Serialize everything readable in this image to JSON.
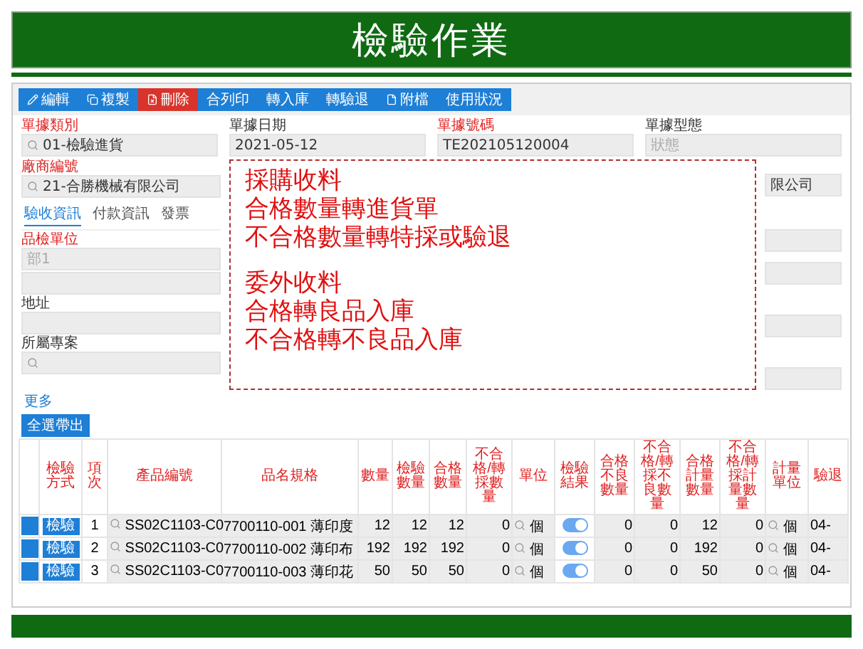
{
  "slide_title": "檢驗作業",
  "toolbar": [
    {
      "label": "編輯",
      "kind": "normal"
    },
    {
      "label": "複製",
      "kind": "normal"
    },
    {
      "label": "刪除",
      "kind": "danger"
    },
    {
      "label": "合列印",
      "kind": "normal"
    },
    {
      "label": "轉入庫",
      "kind": "normal"
    },
    {
      "label": "轉驗退",
      "kind": "normal"
    },
    {
      "label": "附檔",
      "kind": "normal"
    },
    {
      "label": "使用狀況",
      "kind": "normal"
    }
  ],
  "header_fields": [
    {
      "label": "單據類別",
      "required": true,
      "value": "01-檢驗進貨",
      "search": true
    },
    {
      "label": "單據日期",
      "required": false,
      "value": "2021-05-12",
      "search": false
    },
    {
      "label": "單據號碼",
      "required": true,
      "value": "TE202105120004",
      "search": false
    },
    {
      "label": "單據型態",
      "required": false,
      "placeholder": "狀態",
      "search": false
    }
  ],
  "vendor_field": {
    "label": "廠商編號",
    "required": true,
    "value": "21-合勝機械有限公司",
    "search": true
  },
  "right_field": {
    "value": "限公司",
    "search": false
  },
  "tabs": [
    {
      "label": "驗收資訊",
      "selected": true
    },
    {
      "label": "付款資訊",
      "selected": false
    },
    {
      "label": "發票",
      "selected": false
    }
  ],
  "side_fields": [
    {
      "label": "品檢單位",
      "required": true,
      "placeholder": "部1",
      "search": false
    },
    {
      "search": false
    },
    {
      "label": "地址",
      "required": false,
      "search": false
    },
    {
      "label": "所屬專案",
      "required": false,
      "search": true
    }
  ],
  "more_link": "更多",
  "select_button": "全選帶出",
  "callout": [
    [
      "採購收料",
      "合格數量轉進貨單",
      "不合格數量轉特採或驗退"
    ],
    [
      "委外收料",
      "合格轉良品入庫",
      "不合格轉不良品入庫"
    ]
  ],
  "table": {
    "columns": [
      "",
      "檢驗方式",
      "項次",
      "產品編號",
      "品名規格",
      "數量",
      "檢驗數量",
      "合格數量",
      "不合格/轉採數量",
      "單位",
      "檢驗結果",
      "合格不良數量",
      "不合格/轉採不良數量",
      "合格計量數量",
      "不合格/轉採計量數量",
      "計量單位",
      "驗退"
    ],
    "rows": [
      {
        "method": "檢驗",
        "no": "1",
        "product": "SS02C1103-C0",
        "spec": "7700110-001 薄印度",
        "qty": "12",
        "inspected": "12",
        "passed": "12",
        "failed": "0",
        "unit": "個",
        "result_on": true,
        "pass_bad": "0",
        "fail_bad": "0",
        "pass_measure": "12",
        "fail_measure": "0",
        "measure_unit": "個",
        "last": "04-"
      },
      {
        "method": "檢驗",
        "no": "2",
        "product": "SS02C1103-C0",
        "spec": "7700110-002 薄印布",
        "qty": "192",
        "inspected": "192",
        "passed": "192",
        "failed": "0",
        "unit": "個",
        "result_on": true,
        "pass_bad": "0",
        "fail_bad": "0",
        "pass_measure": "192",
        "fail_measure": "0",
        "measure_unit": "個",
        "last": "04-"
      },
      {
        "method": "檢驗",
        "no": "3",
        "product": "SS02C1103-C0",
        "spec": "7700110-003 薄印花",
        "qty": "50",
        "inspected": "50",
        "passed": "50",
        "failed": "0",
        "unit": "個",
        "result_on": true,
        "pass_bad": "0",
        "fail_bad": "0",
        "pass_measure": "50",
        "fail_measure": "0",
        "measure_unit": "個",
        "last": "04-"
      }
    ]
  }
}
